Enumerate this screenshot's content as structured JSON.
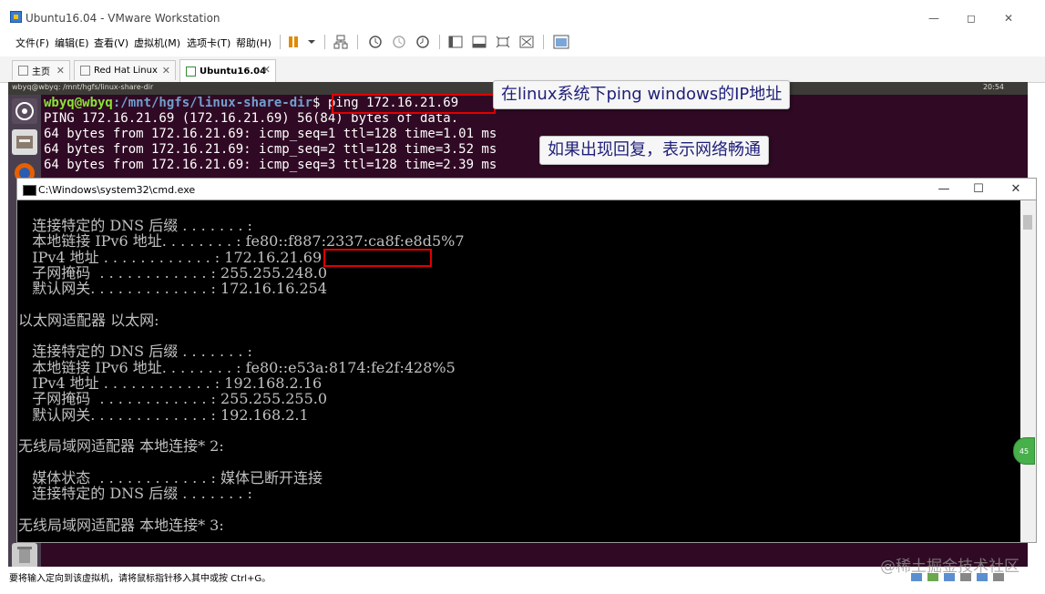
{
  "window": {
    "title": "Ubuntu16.04 - VMware Workstation",
    "controls": [
      "—",
      "◻",
      "✕"
    ]
  },
  "menu": {
    "items": [
      "文件(F)",
      "编辑(E)",
      "查看(V)",
      "虚拟机(M)",
      "选项卡(T)",
      "帮助(H)"
    ]
  },
  "tabs": [
    {
      "label": "主页"
    },
    {
      "label": "Red Hat Linux"
    },
    {
      "label": "Ubuntu16.04"
    }
  ],
  "ubuntu": {
    "topbar_title": "wbyq@wbyq: /mnt/hgfs/linux-share-dir",
    "clock": "20:54",
    "terminal": {
      "prompt_user": "wbyq@wbyq",
      "prompt_path": ":/mnt/hgfs/linux-share-dir",
      "prompt_sign": "$ ",
      "command": "ping 172.16.21.69",
      "lines": [
        "PING 172.16.21.69 (172.16.21.69) 56(84) bytes of data.",
        "64 bytes from 172.16.21.69: icmp_seq=1 ttl=128 time=1.01 ms",
        "64 bytes from 172.16.21.69: icmp_seq=2 ttl=128 time=3.52 ms",
        "64 bytes from 172.16.21.69: icmp_seq=3 ttl=128 time=2.39 ms"
      ]
    }
  },
  "callouts": {
    "ping_note": "在linux系统下ping windows的IP地址",
    "reply_note": "如果出现回复，表示网络畅通"
  },
  "cmd": {
    "title": "C:\\Windows\\system32\\cmd.exe",
    "lines": [
      "   连接特定的 DNS 后缀 . . . . . . . :",
      "   本地链接 IPv6 地址. . . . . . . . : fe80::f887:2337:ca8f:e8d5%7",
      "   IPv4 地址 . . . . . . . . . . . . : 172.16.21.69",
      "   子网掩码  . . . . . . . . . . . . : 255.255.248.0",
      "   默认网关. . . . . . . . . . . . . : 172.16.16.254",
      "",
      "以太网适配器 以太网:",
      "",
      "   连接特定的 DNS 后缀 . . . . . . . :",
      "   本地链接 IPv6 地址. . . . . . . . : fe80::e53a:8174:fe2f:428%5",
      "   IPv4 地址 . . . . . . . . . . . . : 192.168.2.16",
      "   子网掩码  . . . . . . . . . . . . : 255.255.255.0",
      "   默认网关. . . . . . . . . . . . . : 192.168.2.1",
      "",
      "无线局域网适配器 本地连接* 2:",
      "",
      "   媒体状态  . . . . . . . . . . . . : 媒体已断开连接",
      "   连接特定的 DNS 后缀 . . . . . . . :",
      "",
      "无线局域网适配器 本地连接* 3:"
    ],
    "highlight_ip": "172.16.21.69"
  },
  "status_bar": {
    "text": "要将输入定向到该虚拟机，请将鼠标指针移入其中或按 Ctrl+G。"
  },
  "watermark": "@稀土掘金技术社区",
  "badge": "45"
}
